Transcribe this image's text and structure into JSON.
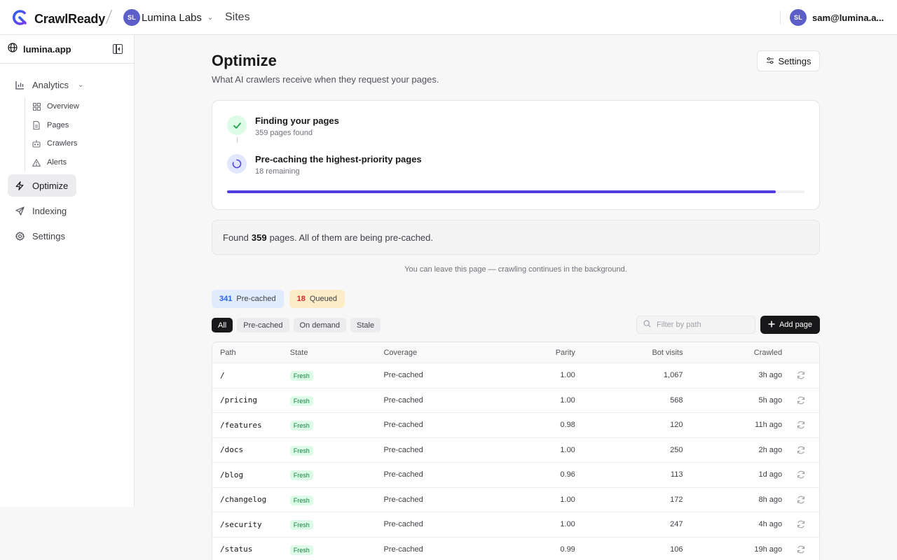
{
  "app": {
    "brand": "CrawlReady",
    "org_initials": "SL",
    "org_name": "Lumina Labs",
    "nav_link": "Sites",
    "user_initials": "SL",
    "user_email": "sam@lumina.a..."
  },
  "sidebar": {
    "site": "lumina.app",
    "analytics_label": "Analytics",
    "sub_items": [
      {
        "label": "Overview",
        "icon": "grid-icon"
      },
      {
        "label": "Pages",
        "icon": "file-icon"
      },
      {
        "label": "Crawlers",
        "icon": "bot-icon"
      },
      {
        "label": "Alerts",
        "icon": "warning-icon"
      }
    ],
    "optimize_label": "Optimize",
    "indexing_label": "Indexing",
    "settings_label": "Settings"
  },
  "header": {
    "title": "Optimize",
    "subtitle": "What AI crawlers receive when they request your pages.",
    "settings_button": "Settings"
  },
  "progress": {
    "step1_title": "Finding your pages",
    "step1_meta": "359 pages found",
    "step2_title": "Pre-caching the highest-priority pages",
    "step2_meta": "18 remaining",
    "fraction": 0.95
  },
  "found": {
    "prefix": "Found",
    "count": "359",
    "suffix": "pages. All of them are being pre-cached."
  },
  "background_note": "You can leave this page — crawling continues in the background.",
  "counters": {
    "precached_count": "341",
    "precached_label": "Pre-cached",
    "queued_count": "18",
    "queued_label": "Queued"
  },
  "filters": {
    "all": "All",
    "precached": "Pre-cached",
    "on_demand": "On demand",
    "stale": "Stale"
  },
  "search": {
    "placeholder": "Filter by path"
  },
  "add_page_label": "Add page",
  "table": {
    "headers": {
      "path": "Path",
      "state": "State",
      "coverage": "Coverage",
      "parity": "Parity",
      "bot_visits": "Bot visits",
      "crawled": "Crawled"
    },
    "rows": [
      {
        "path": "/",
        "state": "Fresh",
        "coverage": "Pre-cached",
        "parity": "1.00",
        "bot_visits": "1,067",
        "crawled": "3h ago"
      },
      {
        "path": "/pricing",
        "state": "Fresh",
        "coverage": "Pre-cached",
        "parity": "1.00",
        "bot_visits": "568",
        "crawled": "5h ago"
      },
      {
        "path": "/features",
        "state": "Fresh",
        "coverage": "Pre-cached",
        "parity": "0.98",
        "bot_visits": "120",
        "crawled": "11h ago"
      },
      {
        "path": "/docs",
        "state": "Fresh",
        "coverage": "Pre-cached",
        "parity": "1.00",
        "bot_visits": "250",
        "crawled": "2h ago"
      },
      {
        "path": "/blog",
        "state": "Fresh",
        "coverage": "Pre-cached",
        "parity": "0.96",
        "bot_visits": "113",
        "crawled": "1d ago"
      },
      {
        "path": "/changelog",
        "state": "Fresh",
        "coverage": "Pre-cached",
        "parity": "1.00",
        "bot_visits": "172",
        "crawled": "8h ago"
      },
      {
        "path": "/security",
        "state": "Fresh",
        "coverage": "Pre-cached",
        "parity": "1.00",
        "bot_visits": "247",
        "crawled": "4h ago"
      },
      {
        "path": "/status",
        "state": "Fresh",
        "coverage": "Pre-cached",
        "parity": "0.99",
        "bot_visits": "106",
        "crawled": "19h ago"
      }
    ]
  },
  "colors": {
    "accent": "#4f3de0",
    "brand_blue": "#2563eb",
    "success": "#16a34a"
  }
}
